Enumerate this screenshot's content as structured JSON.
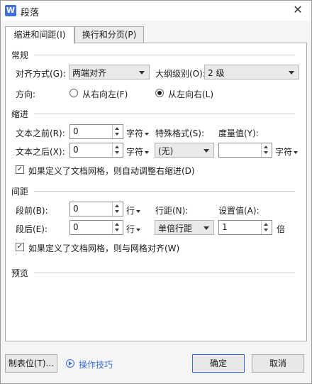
{
  "window": {
    "title": "段落",
    "app_icon": "W",
    "close": "✕"
  },
  "tabs": [
    {
      "label": "缩进和间距(I)",
      "active": true
    },
    {
      "label": "换行和分页(P)",
      "active": false
    }
  ],
  "general": {
    "section": "常规",
    "alignment_label": "对齐方式(G):",
    "alignment_value": "两端对齐",
    "outline_label": "大纲级别(O):",
    "outline_value": "2 级",
    "direction_label": "方向:",
    "rtl_label": "从右向左(F)",
    "ltr_label": "从左向右(L)",
    "selected_direction": "ltr"
  },
  "indent": {
    "section": "缩进",
    "before_label": "文本之前(R):",
    "before_value": "0",
    "before_unit": "字符",
    "after_label": "文本之后(X):",
    "after_value": "0",
    "after_unit": "字符",
    "special_label": "特殊格式(S):",
    "special_value": "(无)",
    "measure_label": "度量值(Y):",
    "measure_value": "",
    "measure_unit": "字符",
    "auto_adjust_label": "如果定义了文档网格，则自动调整右缩进(D)",
    "auto_adjust_checked": true
  },
  "spacing": {
    "section": "间距",
    "before_label": "段前(B):",
    "before_value": "0",
    "before_unit": "行",
    "after_label": "段后(E):",
    "after_value": "0",
    "after_unit": "行",
    "line_label": "行距(N):",
    "line_value": "单倍行距",
    "setting_label": "设置值(A):",
    "setting_value": "1",
    "setting_unit": "倍",
    "grid_align_label": "如果定义了文档网格，则与网格对齐(W)",
    "grid_align_checked": true
  },
  "preview": {
    "section": "预览"
  },
  "footer": {
    "tabs_button": "制表位(T)...",
    "tips_link": "操作技巧",
    "ok_button": "确定",
    "cancel_button": "取消"
  },
  "colors": {
    "accent": "#3a6fd6",
    "panel": "#ffffff",
    "frame": "#f5f5f5"
  }
}
